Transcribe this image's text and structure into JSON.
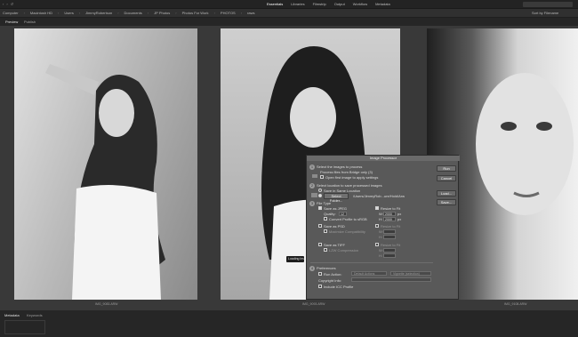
{
  "topbar": {
    "workspaces": [
      "Essentials",
      "Libraries",
      "Filmstrip",
      "Output",
      "Workflow",
      "Metadata"
    ],
    "active_workspace": "Essentials"
  },
  "pathbar": {
    "crumbs": [
      "Computer",
      "Macintosh HD",
      "Users",
      "JimmyRobertson",
      "Documents",
      "JP Photos",
      "Photos For Work",
      "PHOTOS",
      "raws"
    ],
    "sort_label": "Sort by Filename"
  },
  "tabs": {
    "preview": "Preview",
    "publish": "Publish"
  },
  "captions": {
    "photo1": "IMG_9083.ARW",
    "photo2": "IMG_9093.ARW",
    "photo3": "IMG_9108.ARW"
  },
  "bottom": {
    "metadata": "Metadata",
    "keywords": "Keywords"
  },
  "loading": "Loading Image...",
  "dialog": {
    "title": "Image Processor",
    "s1_heading": "Select the images to process",
    "s1_process": "Process files from Bridge only (3)",
    "s1_open_first": "Open first image to apply settings",
    "s2_heading": "Select location to save processed images",
    "s2_same": "Save in Same Location",
    "s2_select_folder": "Select Folder...",
    "s2_path": "/Users/JimmyRob...ure/Hold/Arw",
    "s3_heading": "File Type",
    "jpeg": "Save as JPEG",
    "resize_jpeg": "Resize to Fit",
    "quality_label": "Quality:",
    "quality_value": "12",
    "w_label": "W:",
    "w_value": "2000",
    "h_label": "H:",
    "h_value": "2000",
    "px": "px",
    "srgb": "Convert Profile to sRGB",
    "psd": "Save as PSD",
    "resize_psd": "Resize to Fit",
    "max_compat": "Maximize Compatibility",
    "tiff": "Save as TIFF",
    "resize_tiff": "Resize to Fit",
    "lzw": "LZW Compression",
    "s4_heading": "Preferences",
    "run_action": "Run Action:",
    "action_set": "Default Actions",
    "action_name": "Vignette (selection)",
    "copyright": "Copyright Info:",
    "icc": "Include ICC Profile",
    "run": "Run",
    "cancel": "Cancel",
    "load": "Load...",
    "save": "Save..."
  }
}
